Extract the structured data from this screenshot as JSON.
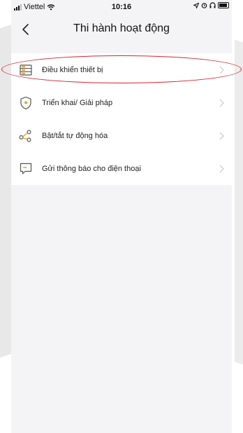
{
  "status_bar": {
    "carrier": "Viettel",
    "time": "10:16",
    "right_icons": [
      "location-icon",
      "alarm-icon",
      "headphones-icon",
      "battery-icon"
    ]
  },
  "nav": {
    "title": "Thi hành hoạt động",
    "back_icon": "chevron-left-icon"
  },
  "actions": [
    {
      "label": "Điều khiển thiết bị",
      "icon": "device-control-icon",
      "highlighted": true
    },
    {
      "label": "Triển khai/ Giải pháp",
      "icon": "shield-icon",
      "highlighted": false
    },
    {
      "label": "Bật/tắt tự động hóa",
      "icon": "automation-nodes-icon",
      "highlighted": false
    },
    {
      "label": "Gửi thông báo cho điện thoại",
      "icon": "message-icon",
      "highlighted": false
    }
  ],
  "colors": {
    "accent_orange": "#f0a020",
    "highlight_red": "#d9232e",
    "background": "#f4f4f6",
    "card": "#ffffff"
  }
}
